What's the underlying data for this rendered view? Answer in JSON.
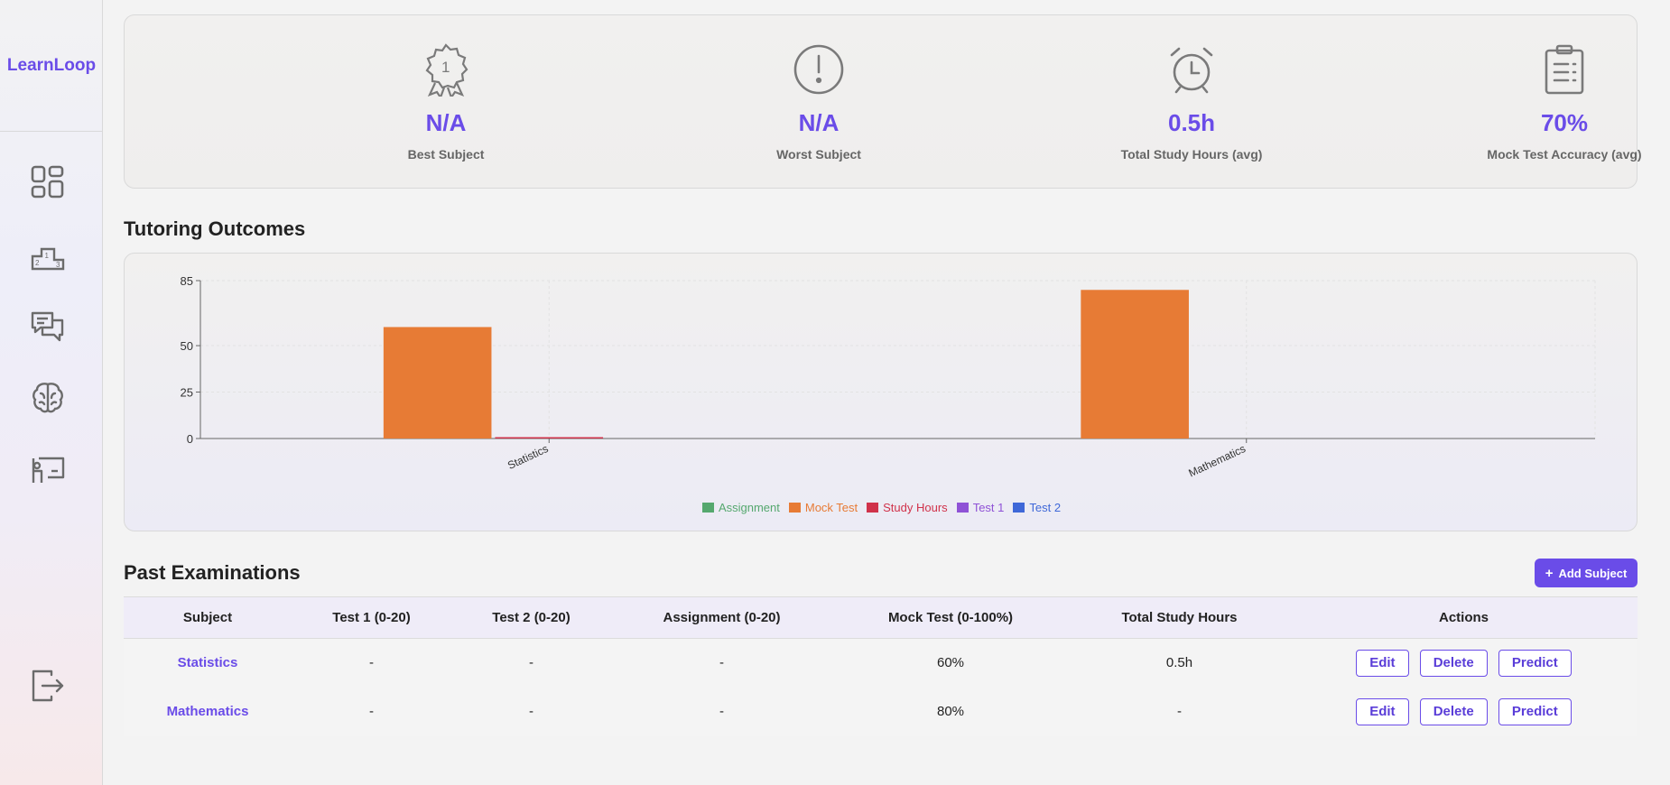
{
  "app": {
    "name": "LearnLoop"
  },
  "sidebar": {
    "items": [
      {
        "icon": "dashboard-icon"
      },
      {
        "icon": "leaderboard-icon"
      },
      {
        "icon": "chat-icon"
      },
      {
        "icon": "brain-icon"
      },
      {
        "icon": "teacher-board-icon"
      }
    ],
    "logout_icon": "logout-icon"
  },
  "stats": [
    {
      "icon": "award-badge-icon",
      "value": "N/A",
      "label": "Best Subject"
    },
    {
      "icon": "alert-circle-icon",
      "value": "N/A",
      "label": "Worst Subject"
    },
    {
      "icon": "alarm-clock-icon",
      "value": "0.5h",
      "label": "Total Study Hours (avg)"
    },
    {
      "icon": "clipboard-list-icon",
      "value": "70%",
      "label": "Mock Test Accuracy (avg)"
    }
  ],
  "outcomes": {
    "title": "Tutoring Outcomes"
  },
  "chart_data": {
    "type": "bar",
    "categories": [
      "Statistics",
      "Mathematics"
    ],
    "series": [
      {
        "name": "Assignment",
        "color": "#55a86e",
        "values": [
          null,
          null
        ]
      },
      {
        "name": "Mock Test",
        "color": "#e77b35",
        "values": [
          60,
          80
        ]
      },
      {
        "name": "Study Hours",
        "color": "#d0324a",
        "values": [
          0.5,
          null
        ]
      },
      {
        "name": "Test 1",
        "color": "#8f52d6",
        "values": [
          null,
          null
        ]
      },
      {
        "name": "Test 2",
        "color": "#3f68d8",
        "values": [
          null,
          null
        ]
      }
    ],
    "yticks": [
      0,
      25,
      50,
      85
    ],
    "ylim": [
      0,
      85
    ],
    "legend_position": "bottom-center",
    "grid": true
  },
  "exams": {
    "title": "Past Examinations",
    "add_button": "Add Subject",
    "columns": [
      "Subject",
      "Test 1 (0-20)",
      "Test 2 (0-20)",
      "Assignment (0-20)",
      "Mock Test (0-100%)",
      "Total Study Hours",
      "Actions"
    ],
    "rows": [
      {
        "subject": "Statistics",
        "test1": "-",
        "test2": "-",
        "assignment": "-",
        "mock": "60%",
        "hours": "0.5h"
      },
      {
        "subject": "Mathematics",
        "test1": "-",
        "test2": "-",
        "assignment": "-",
        "mock": "80%",
        "hours": "-"
      }
    ],
    "actions": {
      "edit": "Edit",
      "delete": "Delete",
      "predict": "Predict"
    }
  }
}
